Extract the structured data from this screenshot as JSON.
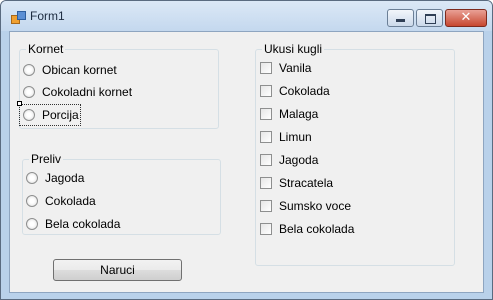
{
  "window": {
    "title": "Form1",
    "close_glyph": "✕",
    "icons": [
      "form-app-icon",
      "minimize-icon",
      "maximize-icon",
      "close-icon"
    ]
  },
  "kornet": {
    "label": "Kornet",
    "options": [
      "Obican kornet",
      "Cokoladni kornet",
      "Porcija"
    ],
    "focused": "Porcija"
  },
  "preliv": {
    "label": "Preliv",
    "options": [
      "Jagoda",
      "Cokolada",
      "Bela cokolada"
    ]
  },
  "ukusi": {
    "label": "Ukusi kugli",
    "options": [
      "Vanila",
      "Cokolada",
      "Malaga",
      "Limun",
      "Jagoda",
      "Stracatela",
      "Sumsko voce",
      "Bela cokolada"
    ]
  },
  "order_button": "Naruci"
}
